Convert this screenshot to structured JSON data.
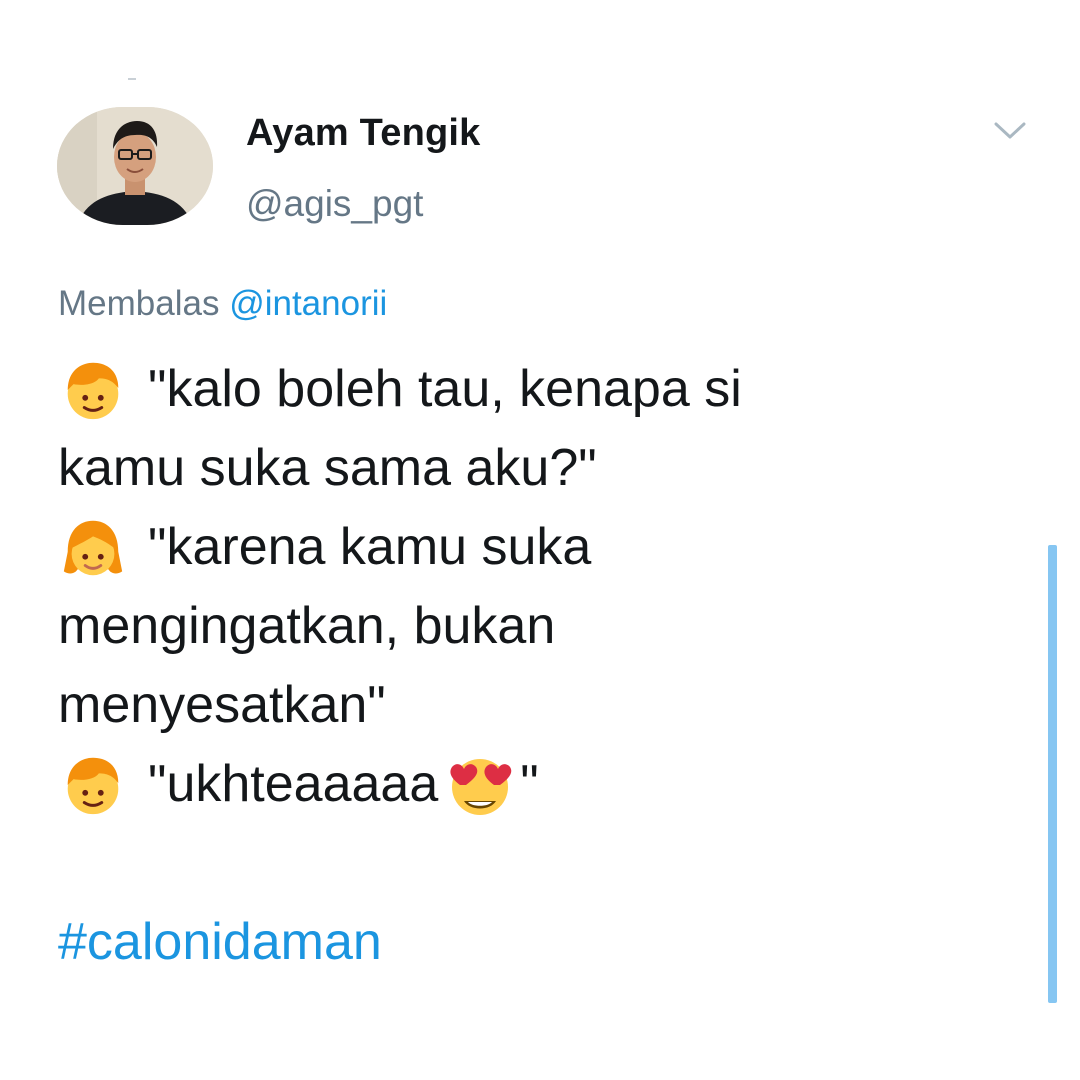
{
  "tweet": {
    "display_name": "Ayam Tengik",
    "handle": "@agis_pgt",
    "reply": {
      "prefix": "Membalas",
      "mention": "@intanorii"
    },
    "lines": {
      "l1": "\"kalo boleh tau, kenapa si",
      "l2": "kamu suka sama aku?\"",
      "l3": "\"karena kamu suka",
      "l4": "mengingatkan, bukan",
      "l5": "menyesatkan\"",
      "l6a": "\"ukhteaaaaa",
      "l6b": "\""
    },
    "hashtag": "#calonidaman",
    "emojis": {
      "boy": "boy-emoji",
      "girl": "girl-emoji",
      "heart_eyes": "smiling-face-with-heart-eyes-emoji"
    }
  },
  "colors": {
    "name": "#14171a",
    "secondary": "#657786",
    "link": "#1b95e0",
    "scrollbar": "#86c6f2"
  }
}
